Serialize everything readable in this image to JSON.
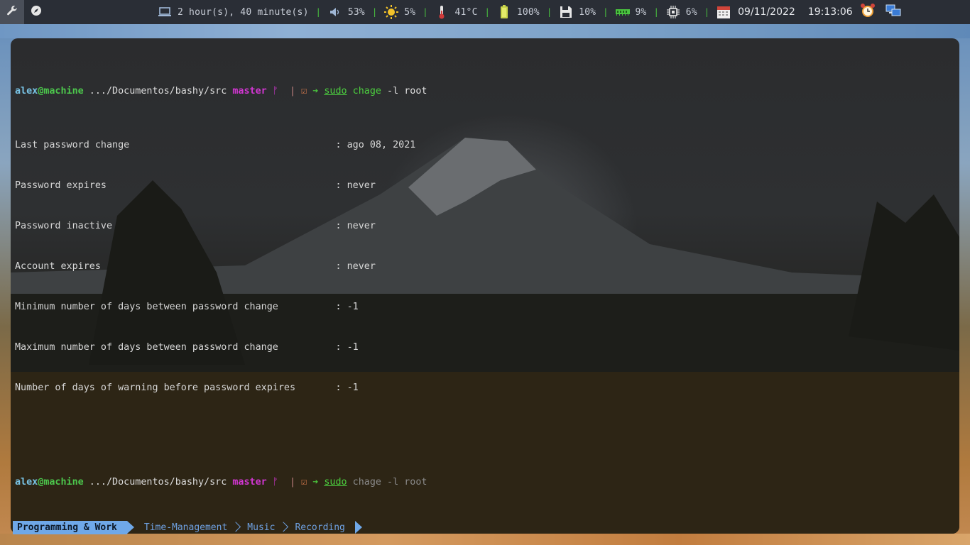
{
  "topbar": {
    "launchers": [
      {
        "icon": "wrench-icon"
      },
      {
        "icon": "compass-icon"
      }
    ],
    "widgets": [
      {
        "name": "uptime",
        "icon": "laptop-icon",
        "value": "2 hour(s), 40 minute(s)"
      },
      {
        "name": "volume",
        "icon": "speaker-icon",
        "value": "53%"
      },
      {
        "name": "brightness",
        "icon": "sun-icon",
        "value": "5%"
      },
      {
        "name": "temperature",
        "icon": "thermometer-icon",
        "value": "41°C"
      },
      {
        "name": "battery",
        "icon": "battery-icon",
        "value": "100%"
      },
      {
        "name": "disk",
        "icon": "floppy-disk-icon",
        "value": "10%"
      },
      {
        "name": "memory",
        "icon": "ram-icon",
        "value": "9%"
      },
      {
        "name": "cpu",
        "icon": "cpu-chip-icon",
        "value": "6%"
      }
    ],
    "date": "09/11/2022",
    "time": "19:13:06",
    "alarm_icon": "alarm-clock-icon",
    "network_icon": "network-icon"
  },
  "terminal": {
    "prompt": {
      "user": "alex",
      "at": "@",
      "host": "machine",
      "path": " .../Documentos/bashy/src ",
      "branch": "master",
      "branch_icon": "git-branch-icon",
      "pipe": "|",
      "check_icon": "checkbox-icon",
      "arrow_icon": "arrow-right-icon"
    },
    "command1": {
      "cmd": "sudo",
      "sub": "chage",
      "args": "-l root"
    },
    "output": [
      {
        "label": "Last password change                                    ",
        "value": ": ago 08, 2021"
      },
      {
        "label": "Password expires                                        ",
        "value": ": never"
      },
      {
        "label": "Password inactive                                       ",
        "value": ": never"
      },
      {
        "label": "Account expires                                         ",
        "value": ": never"
      },
      {
        "label": "Minimum number of days between password change          ",
        "value": ": -1"
      },
      {
        "label": "Maximum number of days between password change          ",
        "value": ": -1"
      },
      {
        "label": "Number of days of warning before password expires       ",
        "value": ": -1"
      }
    ],
    "command2": {
      "cmd": "sudo",
      "suggestion": " chage -l root"
    }
  },
  "workspaces": [
    {
      "label": "Programming & Work",
      "active": true
    },
    {
      "label": "Time-Management",
      "active": false
    },
    {
      "label": "Music",
      "active": false
    },
    {
      "label": "Recording",
      "active": false
    }
  ],
  "colors": {
    "bar_bg": "#2a2e36",
    "separator": "#49c23f",
    "user": "#79c4e6",
    "host": "#4cc64c",
    "branch": "#d136d1",
    "command": "#4ccf3f",
    "tab_active": "#6fa8e8"
  }
}
